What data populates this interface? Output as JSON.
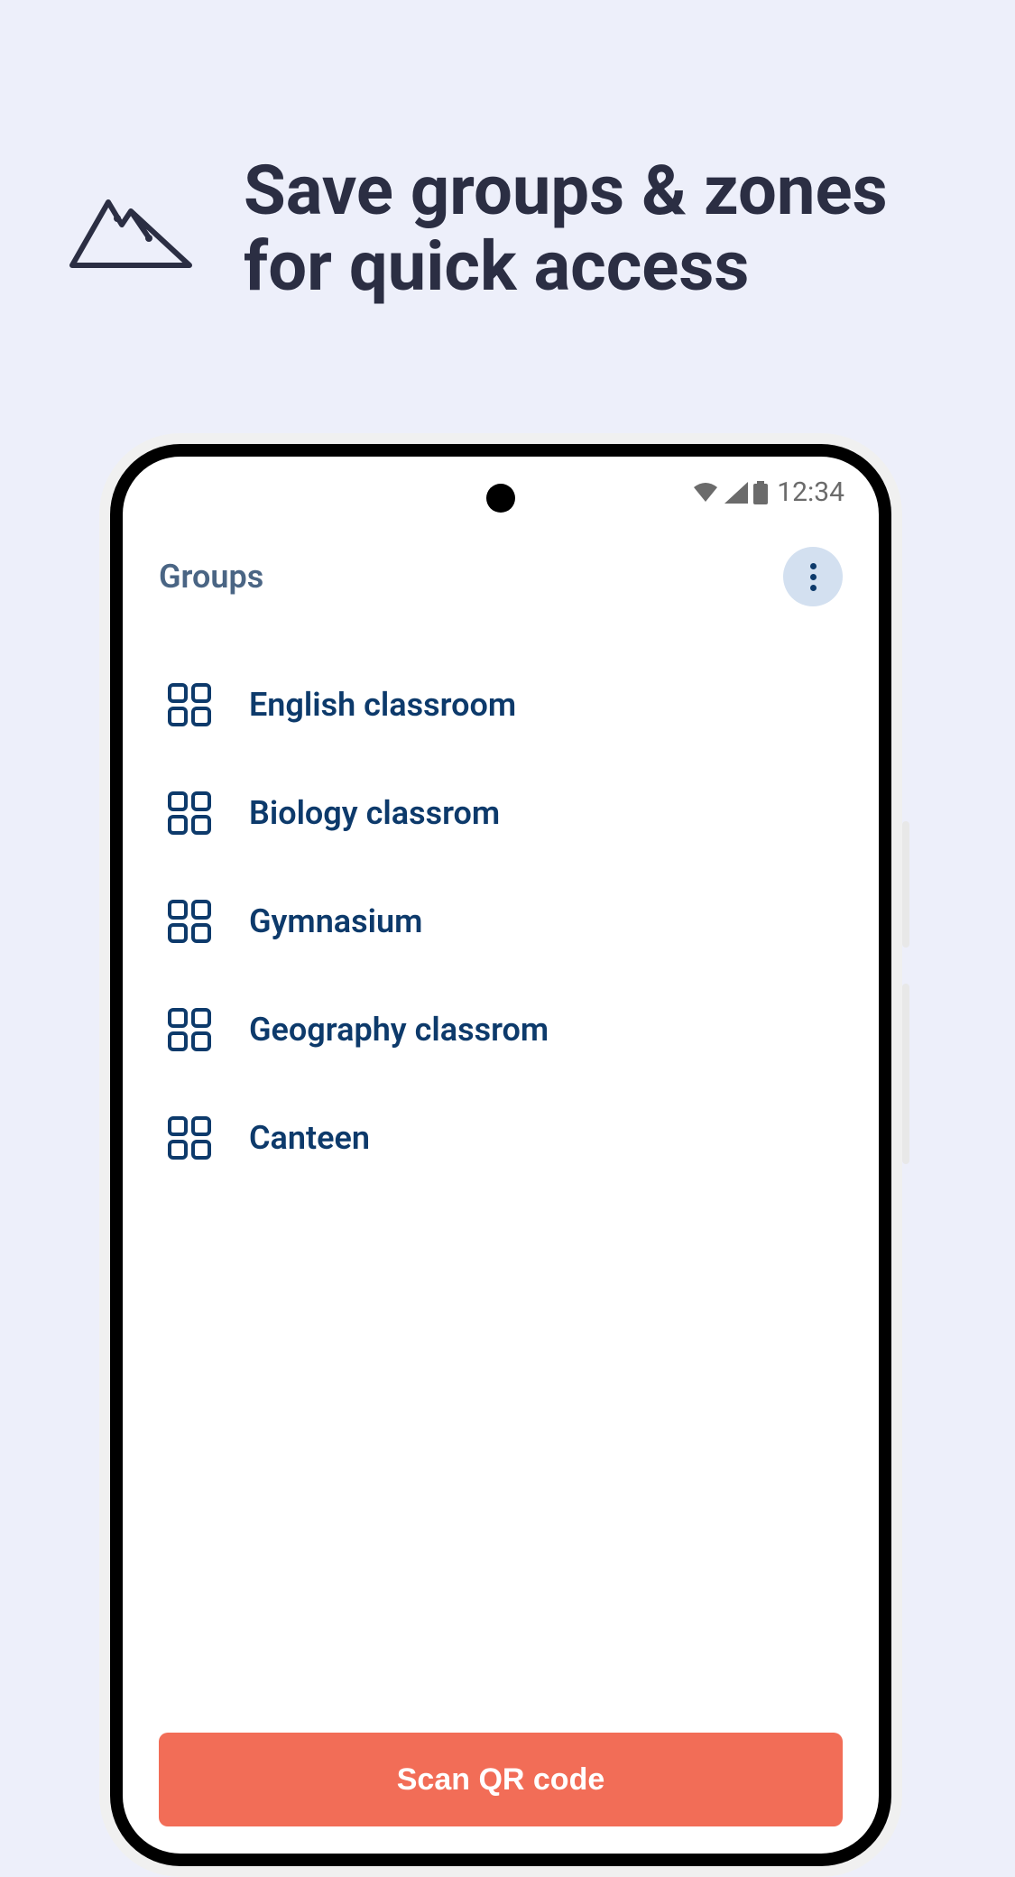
{
  "headline": "Save groups & zones for quick access",
  "status": {
    "time": "12:34"
  },
  "app": {
    "title": "Groups",
    "scan_button": "Scan QR code"
  },
  "groups": [
    {
      "label": "English classroom"
    },
    {
      "label": "Biology classrom"
    },
    {
      "label": "Gymnasium"
    },
    {
      "label": "Geography classrom"
    },
    {
      "label": "Canteen"
    }
  ]
}
